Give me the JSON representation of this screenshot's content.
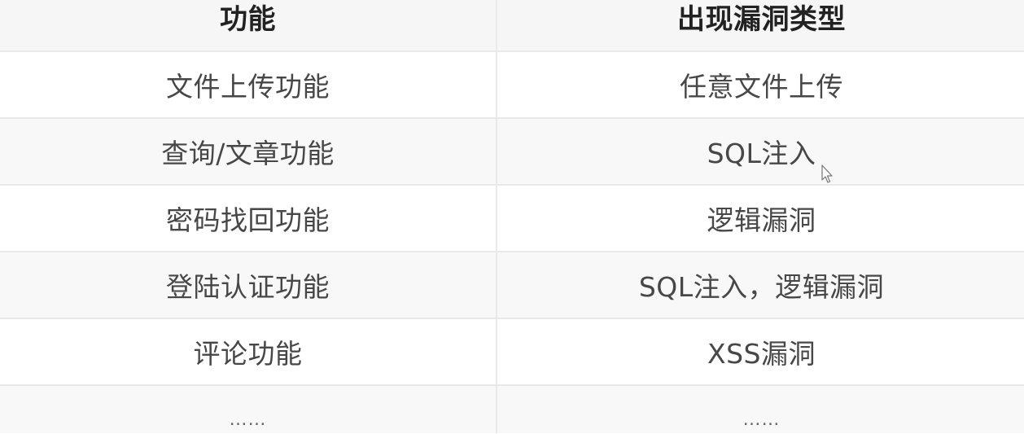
{
  "table": {
    "headers": {
      "function": "功能",
      "vulnerability": "出现漏洞类型"
    },
    "rows": [
      {
        "function": "文件上传功能",
        "vulnerability": "任意文件上传"
      },
      {
        "function": "查询/文章功能",
        "vulnerability": "SQL注入"
      },
      {
        "function": "密码找回功能",
        "vulnerability": "逻辑漏洞"
      },
      {
        "function": "登陆认证功能",
        "vulnerability": "SQL注入，逻辑漏洞"
      },
      {
        "function": "评论功能",
        "vulnerability": "XSS漏洞"
      },
      {
        "function": "……",
        "vulnerability": "……"
      }
    ]
  },
  "colors": {
    "header_bg": "#f6f6f6",
    "row_bg": "#ffffff",
    "alt_row_bg": "#f8f8f8",
    "border": "#e9e9e9",
    "text": "#474747"
  },
  "icons": {
    "cursor": "text-cursor-icon"
  }
}
